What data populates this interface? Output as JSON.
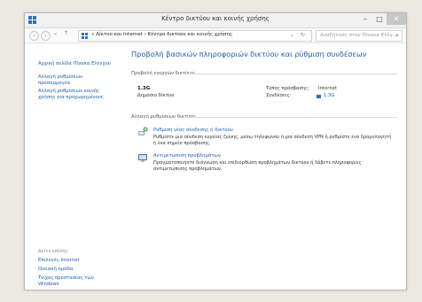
{
  "window": {
    "title": "Κέντρο δικτύου και κοινής χρήσης",
    "minimize": "–",
    "maximize": "□",
    "close": "✕"
  },
  "address": {
    "back": "‹",
    "forward": "›",
    "up": "↑",
    "crumbs": "«  Δίκτυο και Internet  ›  Κέντρο δικτύου και κοινής χρήσης",
    "dropdown": "⌄",
    "refresh": "↻",
    "search_placeholder": "Αναζήτηση στον Πίνακα Ελέγ..."
  },
  "sidebar": {
    "home": "Αρχική σελίδα Πίνακα Ελέγχου",
    "items": [
      "Αλλαγή ρυθμίσεων προσαρμογέα",
      "Αλλαγή ρυθμίσεων κοινής χρήσης για προχωρημένους"
    ],
    "see_also": "Δείτε επίσης",
    "see_also_items": [
      "Επιλογές Internet",
      "Οικιακή ομάδα",
      "Τείχος προστασίας των Windows"
    ]
  },
  "main": {
    "heading": "Προβολή βασικών πληροφοριών δικτύου και ρύθμιση συνδέσεων",
    "active_section": "Προβολή ενεργών δικτύων",
    "network_name": "1.3G",
    "network_type": "Δημόσιο δίκτυο",
    "access_label": "Τύπος πρόσβασης:",
    "access_value": "Internet",
    "connections_label": "Συνδέσεις:",
    "connections_value": "1.3G",
    "change_section": "Αλλαγή ρυθμίσεων δικτύου",
    "tasks": [
      {
        "title": "Ρύθμιση νέας σύνδεσης ή δικτύου",
        "desc": "Ρυθμίστε μια σύνδεση ευρείας ζώνης, μέσω τηλεφώνου ή μια σύνδεση VPN ή ρυθμίστε ένα δρομολογητή ή ένα σημείο πρόσβασης."
      },
      {
        "title": "Αντιμετώπιση προβλημάτων",
        "desc": "Πραγματοποιήστε διάγνωση και επιδιόρθωση προβλημάτων δικτύου ή λάβετε πληροφορίες αντιμετώπισης προβλημάτων."
      }
    ]
  },
  "colors": {
    "link": "#1e5ea8",
    "accent": "#2f6fc4"
  }
}
